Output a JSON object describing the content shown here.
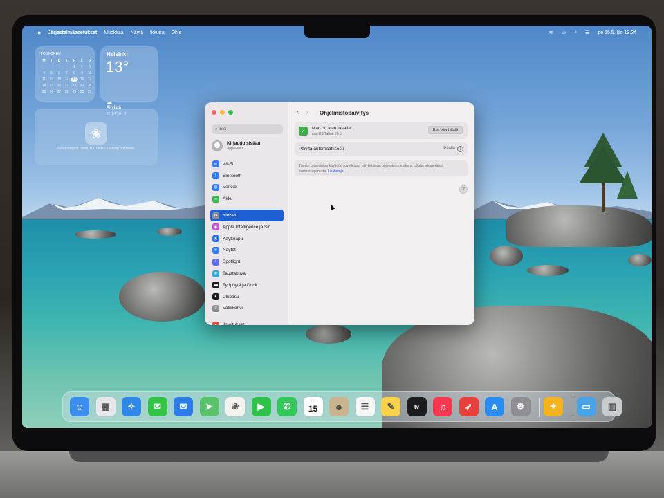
{
  "menubar": {
    "app": "Järjestelmäasetukset",
    "menus": [
      "Muokkaa",
      "Näytä",
      "Ikkuna",
      "Ohje"
    ],
    "datetime": "pe 15.5. klo 13.24"
  },
  "calendar_widget": {
    "month": "TOUKOKUU",
    "weekdays": [
      "M",
      "T",
      "K",
      "T",
      "P",
      "L",
      "S"
    ],
    "days": [
      "",
      "",
      "",
      "",
      "1",
      "2",
      "3",
      "4",
      "5",
      "6",
      "7",
      "8",
      "9",
      "10",
      "11",
      "12",
      "13",
      "14",
      "15",
      "16",
      "17",
      "18",
      "19",
      "20",
      "21",
      "22",
      "23",
      "24",
      "25",
      "26",
      "27",
      "28",
      "29",
      "30",
      "31"
    ],
    "today": "15"
  },
  "weather_widget": {
    "city": "Helsinki",
    "temp": "13°",
    "condition": "Pilvistä",
    "range": "Y: 14° A: 8°"
  },
  "photos_widget": {
    "note": "Kuvat näkyvät tässä, kun niiden käsittely on valmis."
  },
  "settings": {
    "search_placeholder": "Etsi",
    "account_title": "Kirjaudu sisään",
    "account_sub": "Apple-tilillä",
    "sidebar_items": [
      {
        "label": "Wi-Fi",
        "icon": "wifi-icon",
        "color": "#2f7cf6",
        "glyph": "≋"
      },
      {
        "label": "Bluetooth",
        "icon": "bluetooth-icon",
        "color": "#2f7cf6",
        "glyph": "ᛒ"
      },
      {
        "label": "Verkko",
        "icon": "globe-icon",
        "color": "#2f7cf6",
        "glyph": "◍"
      },
      {
        "label": "Akku",
        "icon": "battery-icon",
        "color": "#34b84c",
        "glyph": "▭"
      },
      {
        "label": "Yleiset",
        "icon": "gear-icon",
        "color": "#8e8e93",
        "glyph": "⚙"
      },
      {
        "label": "Apple Intelligence ja Siri",
        "icon": "siri-icon",
        "color": "#c74bd9",
        "glyph": "◉"
      },
      {
        "label": "Käyttöapu",
        "icon": "accessibility-icon",
        "color": "#2f7cf6",
        "glyph": "♿"
      },
      {
        "label": "Näytöt",
        "icon": "display-icon",
        "color": "#2f7cf6",
        "glyph": "☀"
      },
      {
        "label": "Spotlight",
        "icon": "spotlight-icon",
        "color": "#5b6ef0",
        "glyph": "⌕"
      },
      {
        "label": "Taustakuva",
        "icon": "wallpaper-icon",
        "color": "#2fa9d6",
        "glyph": "❋"
      },
      {
        "label": "Työpöytä ja Dock",
        "icon": "dock-icon",
        "color": "#1c1c1e",
        "glyph": "▬"
      },
      {
        "label": "Ulkoasu",
        "icon": "appearance-icon",
        "color": "#1c1c1e",
        "glyph": "◐"
      },
      {
        "label": "Valikkorivi",
        "icon": "menubar-icon",
        "color": "#8e8e93",
        "glyph": "≡"
      },
      {
        "label": "Ilmoitukset",
        "icon": "notifications-icon",
        "color": "#e8453c",
        "glyph": "●"
      }
    ],
    "active_index": 4,
    "pane_title": "Ohjelmistopäivitys",
    "status_title": "Mac on ajan tasalla.",
    "status_sub": "macOS Tahoe 26.5",
    "check_button": "Etsi päivityksiä",
    "auto_label": "Päivitä automaattisesti",
    "auto_value": "Päällä",
    "notice_text": "Tämän ohjelmiston käyttöön sovelletaan päivitettävän ohjelmiston mukana tullutta alkuperäistä lisenssisopimusta.",
    "notice_link": "Lisätietoja..."
  },
  "dock": {
    "calendar_day": "15",
    "tv_label": "tv",
    "apps": [
      {
        "name": "finder",
        "color": "#3a8ef0"
      },
      {
        "name": "launchpad",
        "color": "#e7e7ea"
      },
      {
        "name": "safari",
        "color": "#2f88e8"
      },
      {
        "name": "messages",
        "color": "#33c447"
      },
      {
        "name": "mail",
        "color": "#2d7de8"
      },
      {
        "name": "maps",
        "color": "#5ac26a"
      },
      {
        "name": "photos",
        "color": "#f4f2ef"
      },
      {
        "name": "facetime",
        "color": "#2fc24a"
      },
      {
        "name": "phone",
        "color": "#34c759"
      },
      {
        "name": "calendar",
        "color": "#ffffff"
      },
      {
        "name": "contacts",
        "color": "#c9b48f"
      },
      {
        "name": "reminders",
        "color": "#f6f6f6"
      },
      {
        "name": "notes",
        "color": "#f7d24a"
      },
      {
        "name": "tv",
        "color": "#1c1c1e"
      },
      {
        "name": "music",
        "color": "#f3384f"
      },
      {
        "name": "rocket-app",
        "color": "#e8403a"
      },
      {
        "name": "app-store",
        "color": "#2a8cf2"
      },
      {
        "name": "system-settings",
        "color": "#8e8e93"
      },
      {
        "name": "tips",
        "color": "#f5b321"
      },
      {
        "name": "downloads-folder",
        "color": "#4aa3e6"
      },
      {
        "name": "trash",
        "color": "#c9cbcd"
      }
    ]
  }
}
